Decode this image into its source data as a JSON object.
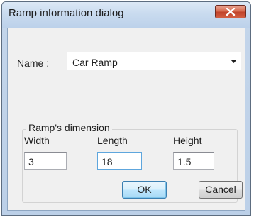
{
  "window": {
    "title": "Ramp information dialog"
  },
  "name_field": {
    "label": "Name :",
    "value": "Car Ramp"
  },
  "dimension_group": {
    "title": "Ramp's dimension",
    "fields": [
      {
        "label": "Width",
        "value": "3"
      },
      {
        "label": "Length",
        "value": "18"
      },
      {
        "label": "Height",
        "value": "1.5"
      }
    ]
  },
  "buttons": {
    "ok": "OK",
    "cancel": "Cancel"
  },
  "icons": {
    "close": "close-icon",
    "dropdown": "chevron-down-icon"
  },
  "colors": {
    "close_button": "#c94a30",
    "title_bar": "#c9dbef",
    "focus_border": "#5ea6dd"
  }
}
